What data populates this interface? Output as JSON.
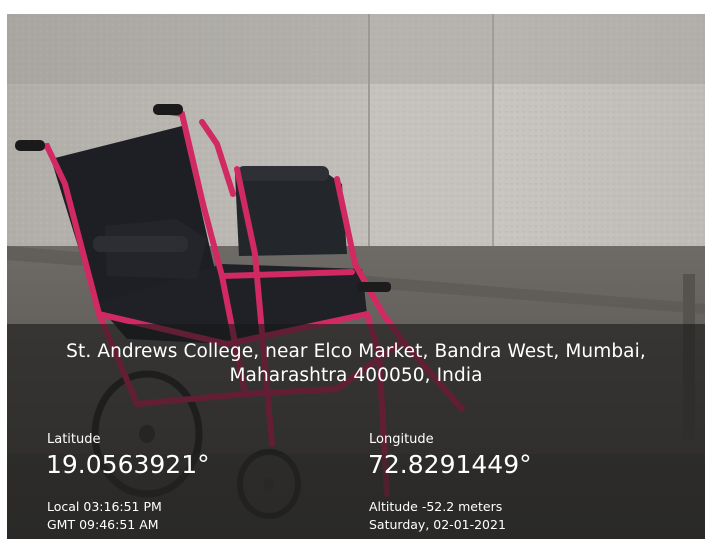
{
  "photo": {
    "subject": "wheelchair-photo",
    "frame_color": "#d12a63"
  },
  "geotag": {
    "address": "St. Andrews College, near Elco Market, Bandra West, Mumbai, Maharashtra 400050, India",
    "latitude_label": "Latitude",
    "latitude_value": "19.0563921°",
    "longitude_label": "Longitude",
    "longitude_value": "72.8291449°",
    "local_time": "Local 03:16:51 PM",
    "gmt_time": "GMT 09:46:51 AM",
    "altitude": "Altitude -52.2 meters",
    "date": "Saturday, 02-01-2021"
  }
}
